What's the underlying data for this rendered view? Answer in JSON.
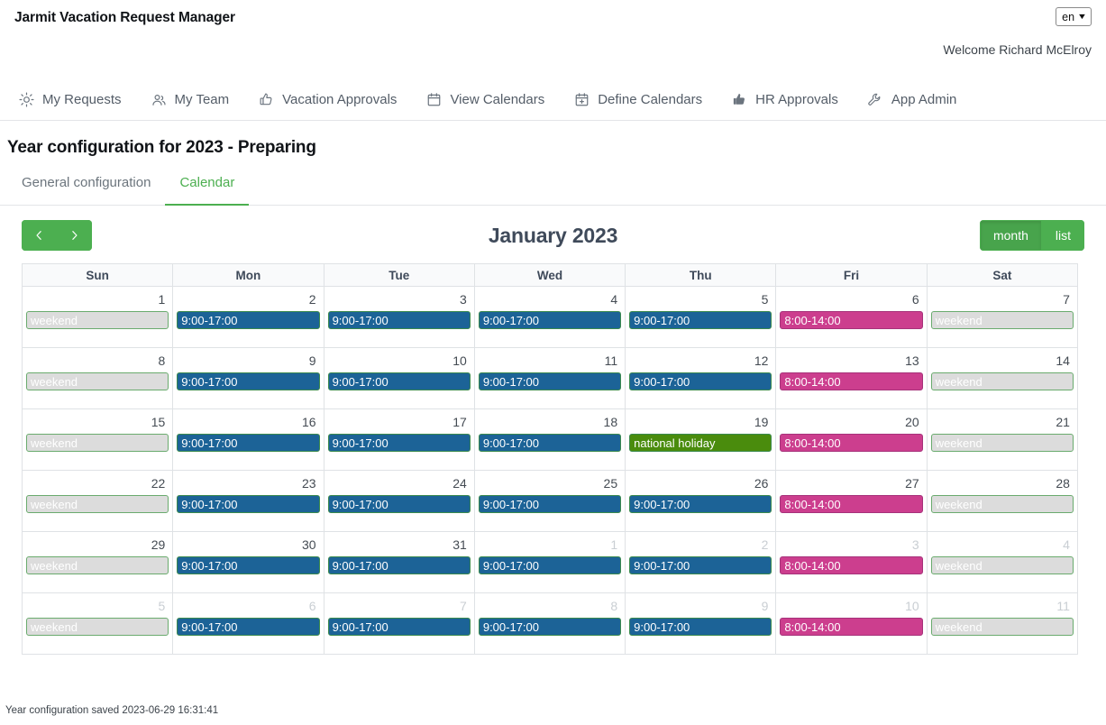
{
  "header": {
    "app_title": "Jarmit Vacation Request Manager",
    "language": "en",
    "welcome": "Welcome Richard McElroy"
  },
  "nav": {
    "items": [
      {
        "label": "My Requests",
        "icon": "sun-icon"
      },
      {
        "label": "My Team",
        "icon": "people-icon"
      },
      {
        "label": "Vacation Approvals",
        "icon": "thumbs-up-outline-icon"
      },
      {
        "label": "View Calendars",
        "icon": "calendar-icon"
      },
      {
        "label": "Define Calendars",
        "icon": "calendar-plus-icon"
      },
      {
        "label": "HR Approvals",
        "icon": "thumbs-up-filled-icon"
      },
      {
        "label": "App Admin",
        "icon": "wrench-icon"
      }
    ]
  },
  "page": {
    "title": "Year configuration for 2023 - Preparing",
    "tabs": [
      {
        "label": "General configuration",
        "active": false
      },
      {
        "label": "Calendar",
        "active": true
      }
    ]
  },
  "calendar_toolbar": {
    "prev_label": "‹",
    "next_label": "›",
    "title": "January 2023",
    "views": [
      {
        "label": "month",
        "active": true
      },
      {
        "label": "list",
        "active": false
      }
    ]
  },
  "calendar": {
    "weekdays": [
      "Sun",
      "Mon",
      "Tue",
      "Wed",
      "Thu",
      "Fri",
      "Sat"
    ],
    "colors": {
      "work": "#1c6397",
      "short": "#cc3e8e",
      "weekend": "#dcdcdc",
      "holiday": "#4a8c0d",
      "accent_green": "#4caf50"
    },
    "weeks": [
      [
        {
          "day": "1",
          "other": false,
          "event": "weekend",
          "type": "weekend"
        },
        {
          "day": "2",
          "other": false,
          "event": "9:00-17:00",
          "type": "work"
        },
        {
          "day": "3",
          "other": false,
          "event": "9:00-17:00",
          "type": "work"
        },
        {
          "day": "4",
          "other": false,
          "event": "9:00-17:00",
          "type": "work"
        },
        {
          "day": "5",
          "other": false,
          "event": "9:00-17:00",
          "type": "work"
        },
        {
          "day": "6",
          "other": false,
          "event": "8:00-14:00",
          "type": "short"
        },
        {
          "day": "7",
          "other": false,
          "event": "weekend",
          "type": "weekend"
        }
      ],
      [
        {
          "day": "8",
          "other": false,
          "event": "weekend",
          "type": "weekend"
        },
        {
          "day": "9",
          "other": false,
          "event": "9:00-17:00",
          "type": "work"
        },
        {
          "day": "10",
          "other": false,
          "event": "9:00-17:00",
          "type": "work"
        },
        {
          "day": "11",
          "other": false,
          "event": "9:00-17:00",
          "type": "work"
        },
        {
          "day": "12",
          "other": false,
          "event": "9:00-17:00",
          "type": "work"
        },
        {
          "day": "13",
          "other": false,
          "event": "8:00-14:00",
          "type": "short"
        },
        {
          "day": "14",
          "other": false,
          "event": "weekend",
          "type": "weekend"
        }
      ],
      [
        {
          "day": "15",
          "other": false,
          "event": "weekend",
          "type": "weekend"
        },
        {
          "day": "16",
          "other": false,
          "event": "9:00-17:00",
          "type": "work"
        },
        {
          "day": "17",
          "other": false,
          "event": "9:00-17:00",
          "type": "work"
        },
        {
          "day": "18",
          "other": false,
          "event": "9:00-17:00",
          "type": "work"
        },
        {
          "day": "19",
          "other": false,
          "event": "national holiday",
          "type": "holiday"
        },
        {
          "day": "20",
          "other": false,
          "event": "8:00-14:00",
          "type": "short"
        },
        {
          "day": "21",
          "other": false,
          "event": "weekend",
          "type": "weekend"
        }
      ],
      [
        {
          "day": "22",
          "other": false,
          "event": "weekend",
          "type": "weekend"
        },
        {
          "day": "23",
          "other": false,
          "event": "9:00-17:00",
          "type": "work"
        },
        {
          "day": "24",
          "other": false,
          "event": "9:00-17:00",
          "type": "work"
        },
        {
          "day": "25",
          "other": false,
          "event": "9:00-17:00",
          "type": "work"
        },
        {
          "day": "26",
          "other": false,
          "event": "9:00-17:00",
          "type": "work"
        },
        {
          "day": "27",
          "other": false,
          "event": "8:00-14:00",
          "type": "short"
        },
        {
          "day": "28",
          "other": false,
          "event": "weekend",
          "type": "weekend"
        }
      ],
      [
        {
          "day": "29",
          "other": false,
          "event": "weekend",
          "type": "weekend"
        },
        {
          "day": "30",
          "other": false,
          "event": "9:00-17:00",
          "type": "work"
        },
        {
          "day": "31",
          "other": false,
          "event": "9:00-17:00",
          "type": "work"
        },
        {
          "day": "1",
          "other": true,
          "event": "9:00-17:00",
          "type": "work"
        },
        {
          "day": "2",
          "other": true,
          "event": "9:00-17:00",
          "type": "work"
        },
        {
          "day": "3",
          "other": true,
          "event": "8:00-14:00",
          "type": "short"
        },
        {
          "day": "4",
          "other": true,
          "event": "weekend",
          "type": "weekend"
        }
      ],
      [
        {
          "day": "5",
          "other": true,
          "event": "weekend",
          "type": "weekend"
        },
        {
          "day": "6",
          "other": true,
          "event": "9:00-17:00",
          "type": "work"
        },
        {
          "day": "7",
          "other": true,
          "event": "9:00-17:00",
          "type": "work"
        },
        {
          "day": "8",
          "other": true,
          "event": "9:00-17:00",
          "type": "work"
        },
        {
          "day": "9",
          "other": true,
          "event": "9:00-17:00",
          "type": "work"
        },
        {
          "day": "10",
          "other": true,
          "event": "8:00-14:00",
          "type": "short"
        },
        {
          "day": "11",
          "other": true,
          "event": "weekend",
          "type": "weekend"
        }
      ]
    ]
  },
  "footer": {
    "status": "Year configuration saved 2023-06-29 16:31:41"
  }
}
